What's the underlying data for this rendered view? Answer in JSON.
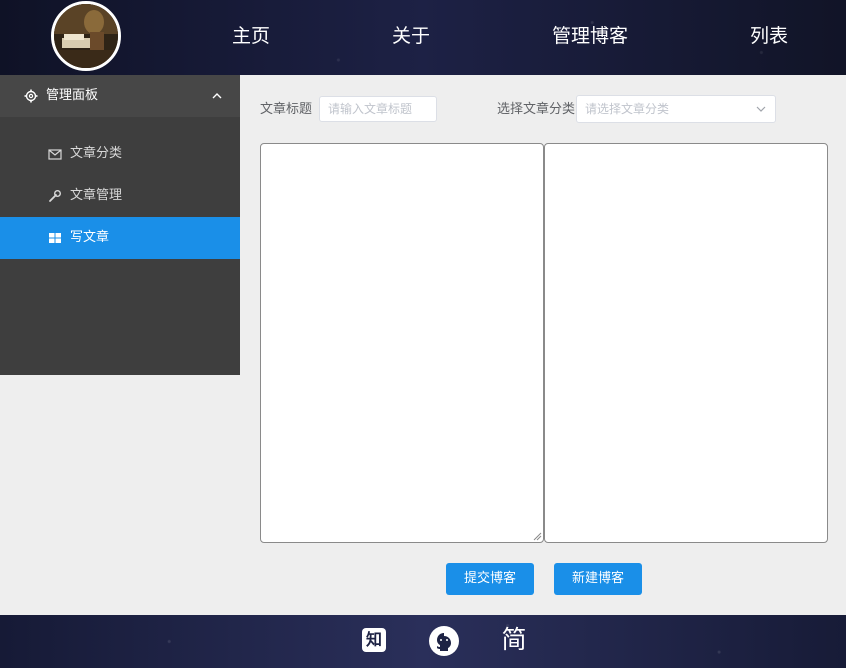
{
  "header": {
    "nav": [
      "主页",
      "关于",
      "管理博客",
      "列表"
    ]
  },
  "sidebar": {
    "title": "管理面板",
    "title_icon": "gear-icon",
    "items": [
      {
        "label": "文章分类",
        "icon": "mail-icon"
      },
      {
        "label": "文章管理",
        "icon": "wrench-icon"
      },
      {
        "label": "写文章",
        "icon": "grid-icon",
        "active": true
      }
    ]
  },
  "form": {
    "title_label": "文章标题",
    "title_placeholder": "请输入文章标题",
    "category_label": "选择文章分类",
    "category_placeholder": "请选择文章分类"
  },
  "buttons": {
    "submit": "提交博客",
    "new": "新建博客"
  },
  "footer": {
    "zhihu_glyph": "知",
    "jianshu_glyph": "简"
  },
  "colors": {
    "accent": "#1a8fe8",
    "sidebar_bg": "#3e3e3e",
    "page_bg": "#eeeeee"
  }
}
